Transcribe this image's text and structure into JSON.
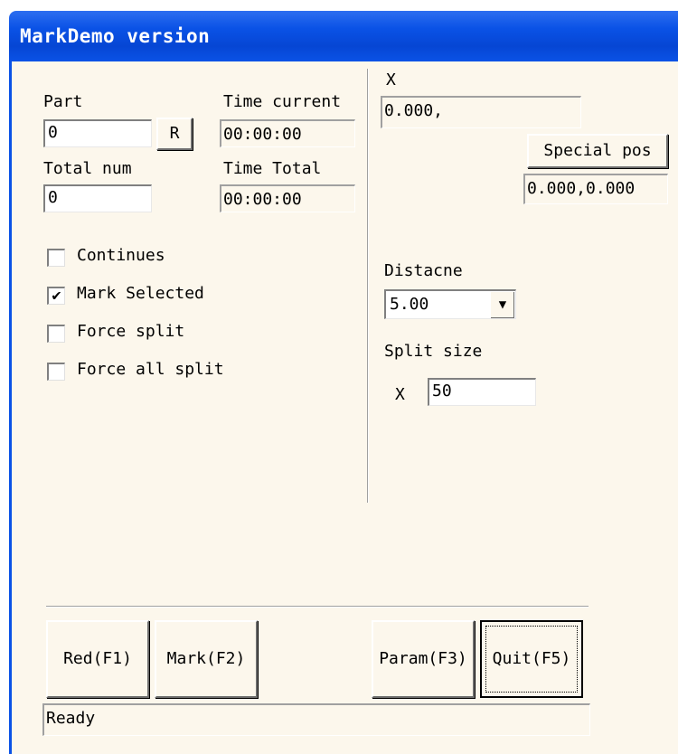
{
  "window": {
    "title": "MarkDemo version"
  },
  "part": {
    "label": "Part",
    "value": "0",
    "reset_label": "R"
  },
  "total_num": {
    "label": "Total num",
    "value": "0"
  },
  "time_current": {
    "label": "Time current",
    "value": "00:00:00"
  },
  "time_total": {
    "label": "Time Total",
    "value": "00:00:00"
  },
  "options": {
    "continues": {
      "label": "Continues",
      "checked": false
    },
    "mark_selected": {
      "label": "Mark Selected",
      "checked": true
    },
    "force_split": {
      "label": "Force split",
      "checked": false
    },
    "force_all_split": {
      "label": "Force all split",
      "checked": false
    }
  },
  "position": {
    "x_label": "X",
    "x_value": "0.000,",
    "special_label": "Special pos",
    "special_value": "0.000,0.000"
  },
  "distance": {
    "label": "Distacne",
    "selected": "5.00"
  },
  "split_size": {
    "label": "Split size",
    "x_label": "X",
    "value": "50"
  },
  "buttons": {
    "red": "Red(F1)",
    "mark": "Mark(F2)",
    "param": "Param(F3)",
    "quit": "Quit(F5)"
  },
  "status": {
    "text": "Ready"
  }
}
